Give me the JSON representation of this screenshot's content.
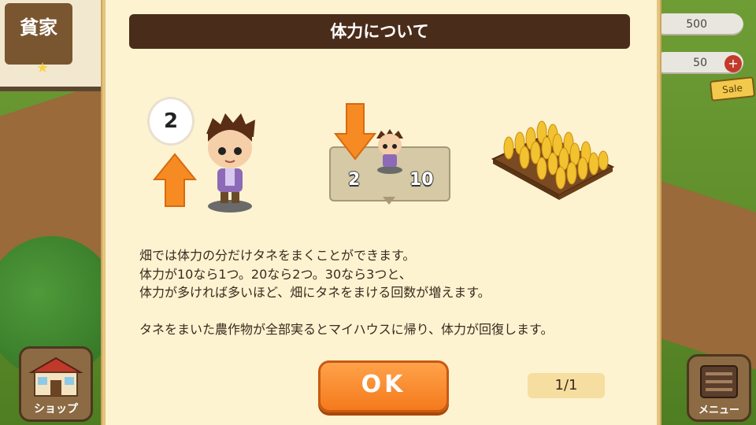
{
  "hud": {
    "status_badge": "貧家",
    "money_value": "500",
    "coin_value": "50",
    "sale_label": "Sale",
    "shop_label": "ショップ",
    "menu_label": "メニュー"
  },
  "dialog": {
    "title": "体力について",
    "bubble_value": "2",
    "hint_left_value": "2",
    "hint_right_value": "10",
    "message_lines": [
      "畑では体力の分だけタネをまくことができます。",
      "体力が10なら1つ。20なら2つ。30なら3つと、",
      "体力が多ければ多いほど、畑にタネをまける回数が増えます。",
      "タネをまいた農作物が全部実るとマイハウスに帰り、体力が回復します。"
    ],
    "ok_label": "OK",
    "pager": "1/1"
  },
  "icons": [
    "arrow-up-icon",
    "arrow-down-icon",
    "avatar-icon",
    "wheat-field-icon",
    "shop-icon",
    "menu-icon",
    "plus-icon",
    "star-icon"
  ],
  "colors": {
    "title_bar": "#4a2c1a",
    "dialog_bg": "#fdf3d1",
    "ok_button": "#f47a1c",
    "arrow": "#f58b22"
  }
}
